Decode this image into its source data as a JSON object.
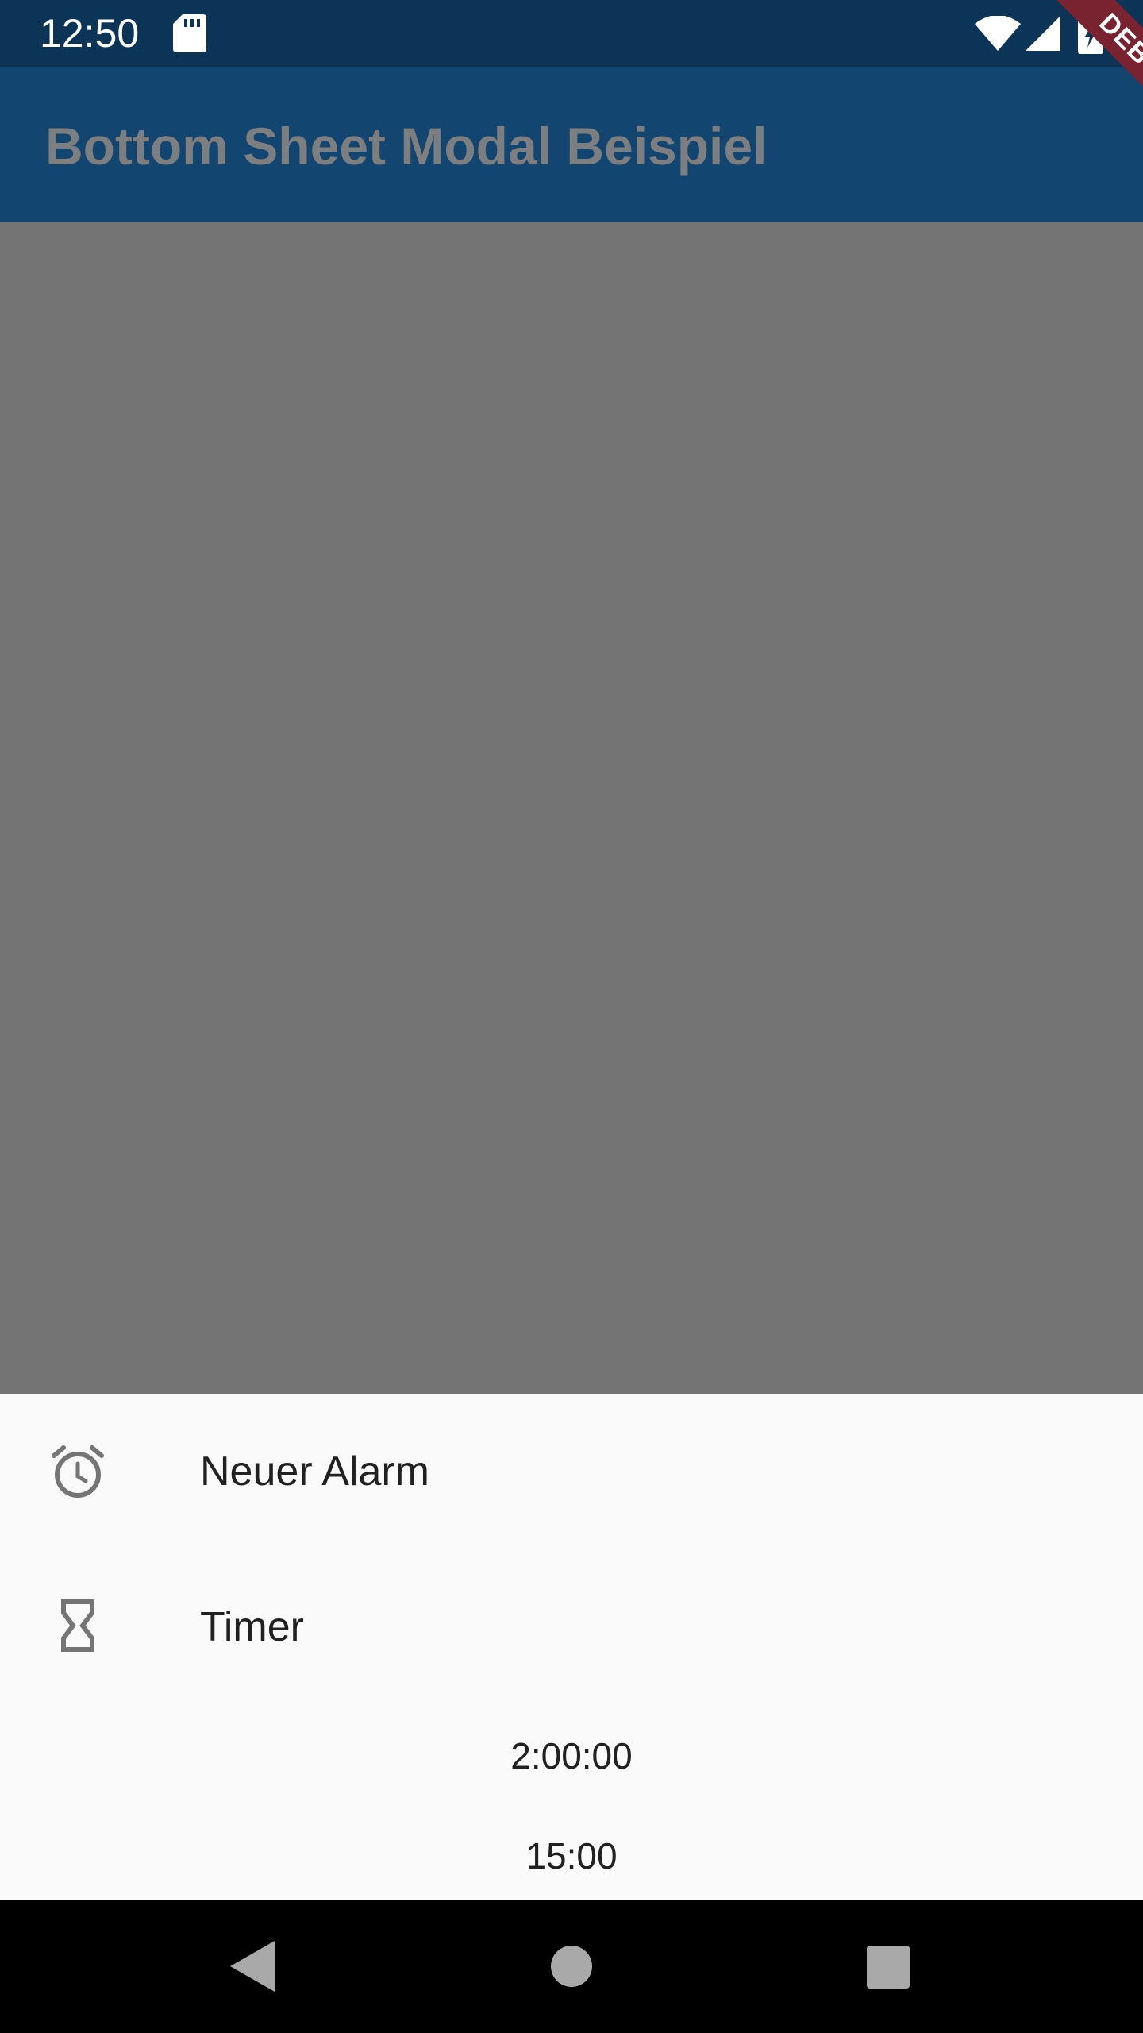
{
  "status_bar": {
    "time": "12:50",
    "icons": [
      "sd-card-icon",
      "wifi-icon",
      "signal-icon",
      "battery-charging-icon"
    ]
  },
  "app_bar": {
    "title": "Bottom Sheet Modal Beispiel"
  },
  "debug_banner": {
    "label": "DEBUG"
  },
  "bottom_sheet": {
    "items": [
      {
        "label": "Neuer Alarm",
        "icon": "alarm-icon"
      },
      {
        "label": "Timer",
        "icon": "hourglass-icon"
      }
    ],
    "timer_values": [
      "2:00:00",
      "15:00"
    ]
  },
  "nav_bar": {
    "buttons": [
      "back-icon",
      "home-icon",
      "recents-icon"
    ]
  },
  "colors": {
    "status_bar": "#0c3457",
    "app_bar": "#12456f",
    "scrim": "#747474",
    "sheet": "#fafafa",
    "debug_ribbon": "#7a2330"
  }
}
